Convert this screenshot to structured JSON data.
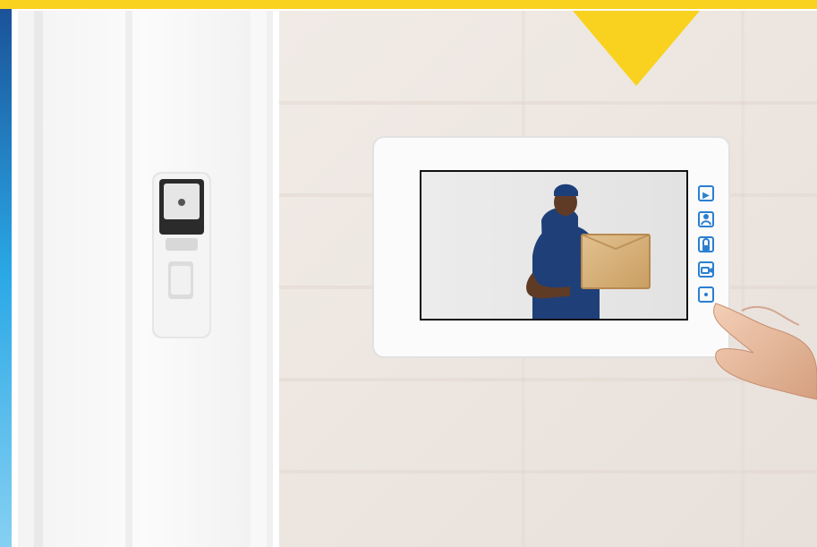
{
  "image": {
    "description_alt": "",
    "top_banner_color": "#f8d21f",
    "left_edge_color": "#1f7fcf",
    "outdoor_station": {
      "body_color": "#f4f4f4",
      "top_color": "#2a2a2a"
    },
    "indoor_monitor": {
      "frame_color": "#fbfbfb",
      "button_icons": [
        "play-pause-icon",
        "person-icon",
        "door-lock-icon",
        "camera-icon",
        "dot-icon"
      ]
    },
    "screen_content": {
      "subject": "delivery-person-holding-box"
    },
    "hand": {
      "skin_color": "#e8b89a"
    }
  }
}
